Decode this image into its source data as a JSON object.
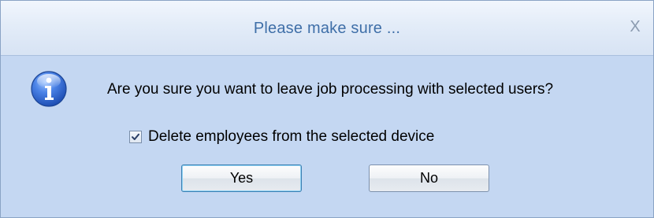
{
  "dialog": {
    "title": "Please make sure ...",
    "close_label": "X",
    "icon": "info-icon",
    "message": "Are you sure you want to leave job processing with selected users?",
    "checkbox": {
      "label": "Delete employees from the selected device",
      "checked": true
    },
    "buttons": {
      "yes_label": "Yes",
      "no_label": "No"
    },
    "colors": {
      "title_text": "#3f6fa8",
      "body_background": "#c4d7f2",
      "info_icon": "#2f63c9"
    }
  }
}
